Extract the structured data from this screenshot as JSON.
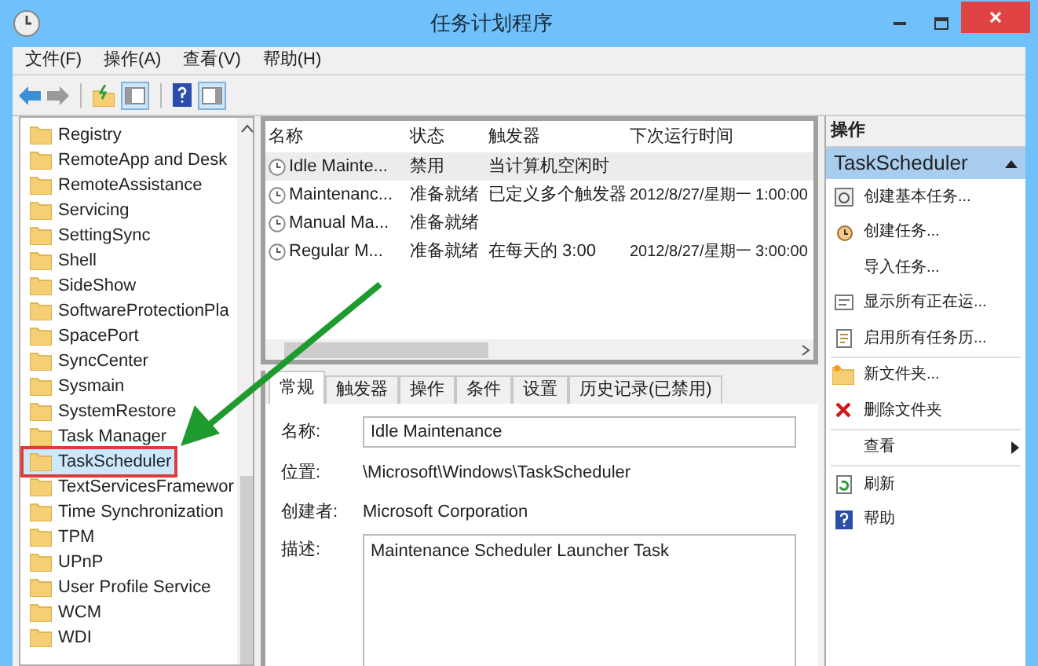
{
  "window": {
    "title": "任务计划程序"
  },
  "menu": [
    "文件(F)",
    "操作(A)",
    "查看(V)",
    "帮助(H)"
  ],
  "tree": {
    "items": [
      {
        "label": "Registry",
        "selected": false
      },
      {
        "label": "RemoteApp and Desk",
        "selected": false
      },
      {
        "label": "RemoteAssistance",
        "selected": false
      },
      {
        "label": "Servicing",
        "selected": false
      },
      {
        "label": "SettingSync",
        "selected": false
      },
      {
        "label": "Shell",
        "selected": false
      },
      {
        "label": "SideShow",
        "selected": false
      },
      {
        "label": "SoftwareProtectionPla",
        "selected": false
      },
      {
        "label": "SpacePort",
        "selected": false
      },
      {
        "label": "SyncCenter",
        "selected": false
      },
      {
        "label": "Sysmain",
        "selected": false
      },
      {
        "label": "SystemRestore",
        "selected": false
      },
      {
        "label": "Task Manager",
        "selected": false
      },
      {
        "label": "TaskScheduler",
        "selected": true
      },
      {
        "label": "TextServicesFramewor",
        "selected": false
      },
      {
        "label": "Time Synchronization",
        "selected": false
      },
      {
        "label": "TPM",
        "selected": false
      },
      {
        "label": "UPnP",
        "selected": false
      },
      {
        "label": "User Profile Service",
        "selected": false
      },
      {
        "label": "WCM",
        "selected": false
      },
      {
        "label": "WDI",
        "selected": false
      }
    ]
  },
  "task_table": {
    "columns": [
      "名称",
      "状态",
      "触发器",
      "下次运行时间"
    ],
    "rows": [
      {
        "cells": [
          "Idle Mainte...",
          "禁用",
          "当计算机空闲时",
          ""
        ],
        "selected": true
      },
      {
        "cells": [
          "Maintenanc...",
          "准备就绪",
          "已定义多个触发器",
          "2012/8/27/星期一 1:00:00"
        ],
        "selected": false
      },
      {
        "cells": [
          "Manual Ma...",
          "准备就绪",
          "",
          ""
        ],
        "selected": false
      },
      {
        "cells": [
          "Regular M...",
          "准备就绪",
          "在每天的 3:00",
          "2012/8/27/星期一 3:00:00"
        ],
        "selected": false
      }
    ]
  },
  "tabs": [
    {
      "label": "常规",
      "selected": true
    },
    {
      "label": "触发器",
      "selected": false
    },
    {
      "label": "操作",
      "selected": false
    },
    {
      "label": "条件",
      "selected": false
    },
    {
      "label": "设置",
      "selected": false
    },
    {
      "label": "历史记录(已禁用)",
      "selected": false
    }
  ],
  "details": [
    {
      "label": "名称:",
      "value": "Idle Maintenance",
      "kind": "input"
    },
    {
      "label": "位置:",
      "value": "\\Microsoft\\Windows\\TaskScheduler",
      "kind": "text"
    },
    {
      "label": "创建者:",
      "value": "Microsoft Corporation",
      "kind": "text"
    },
    {
      "label": "描述:",
      "value": "Maintenance Scheduler Launcher Task",
      "kind": "textarea"
    }
  ],
  "actions": {
    "title": "操作",
    "group": "TaskScheduler",
    "expanded": true,
    "items": [
      {
        "label": "创建基本任务...",
        "separator_before": false,
        "submenu": false
      },
      {
        "label": "创建任务...",
        "separator_before": false,
        "submenu": false
      },
      {
        "label": "导入任务...",
        "separator_before": false,
        "submenu": false
      },
      {
        "label": "显示所有正在运...",
        "separator_before": false,
        "submenu": false
      },
      {
        "label": "启用所有任务历...",
        "separator_before": false,
        "submenu": false
      },
      {
        "label": "新文件夹...",
        "separator_before": true,
        "submenu": false
      },
      {
        "label": "删除文件夹",
        "separator_before": false,
        "submenu": false
      },
      {
        "label": "查看",
        "separator_before": true,
        "submenu": true
      },
      {
        "label": "刷新",
        "separator_before": true,
        "submenu": false
      },
      {
        "label": "帮助",
        "separator_before": false,
        "submenu": false
      }
    ]
  }
}
